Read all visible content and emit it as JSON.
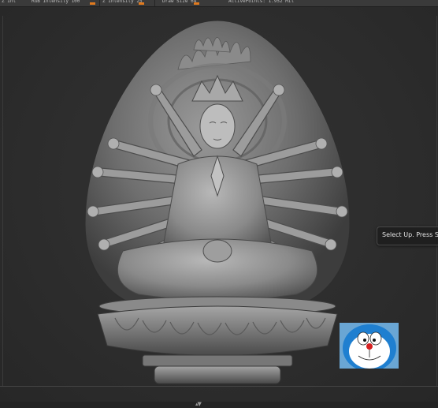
{
  "toolbar": {
    "items": [
      {
        "label": "Z Int"
      },
      {
        "label": "RGB Intensity 100"
      },
      {
        "label": "Z Intensity 25"
      },
      {
        "label": "Draw Size 64"
      },
      {
        "label": "ActivePoints: 1.952 Mil"
      }
    ],
    "accent": "#e07a1f"
  },
  "viewport": {
    "background": "#2b2b2b",
    "model_icon": "buddha-relief-sculpt"
  },
  "tooltip": {
    "text": "Select Up. Press Sh"
  },
  "thumbnail": {
    "icon": "doraemon-thumbnail"
  },
  "bottom": {
    "arrows": "▴▼"
  }
}
